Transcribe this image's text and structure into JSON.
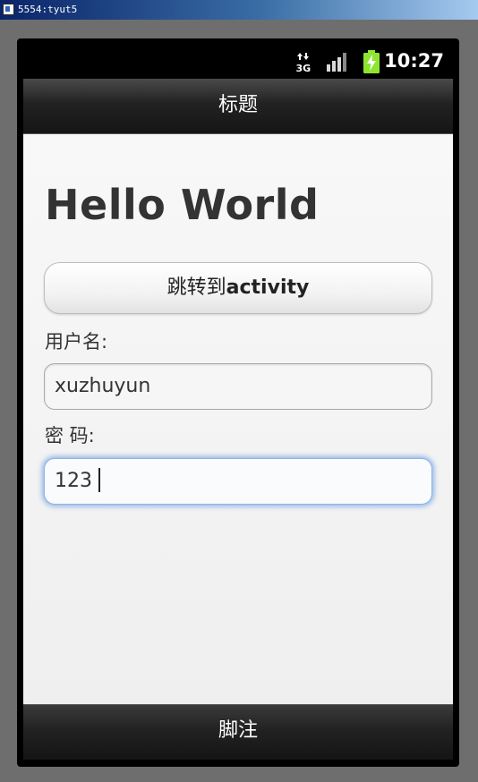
{
  "window": {
    "title": "5554:tyut5"
  },
  "status_bar": {
    "network_type": "3G",
    "time": "10:27",
    "colors": {
      "battery": "#8ee52f",
      "text": "#ffffff"
    }
  },
  "action_bar": {
    "title": "标题"
  },
  "content": {
    "hello_text": "Hello World",
    "jump_button": {
      "label_prefix": "跳转到",
      "label_strong": "activity"
    },
    "username_label": "用户名:",
    "username_value": "xuzhuyun",
    "password_label": "密 码:",
    "password_value": "123"
  },
  "footer": {
    "label": "脚注"
  },
  "colors": {
    "focus_glow": "#8fb3e6",
    "bar_dark": "#1a1a1a",
    "content_bg": "#f3f3f3"
  },
  "icons": [
    "3g-data-icon",
    "signal-strength-icon",
    "battery-charging-icon"
  ]
}
